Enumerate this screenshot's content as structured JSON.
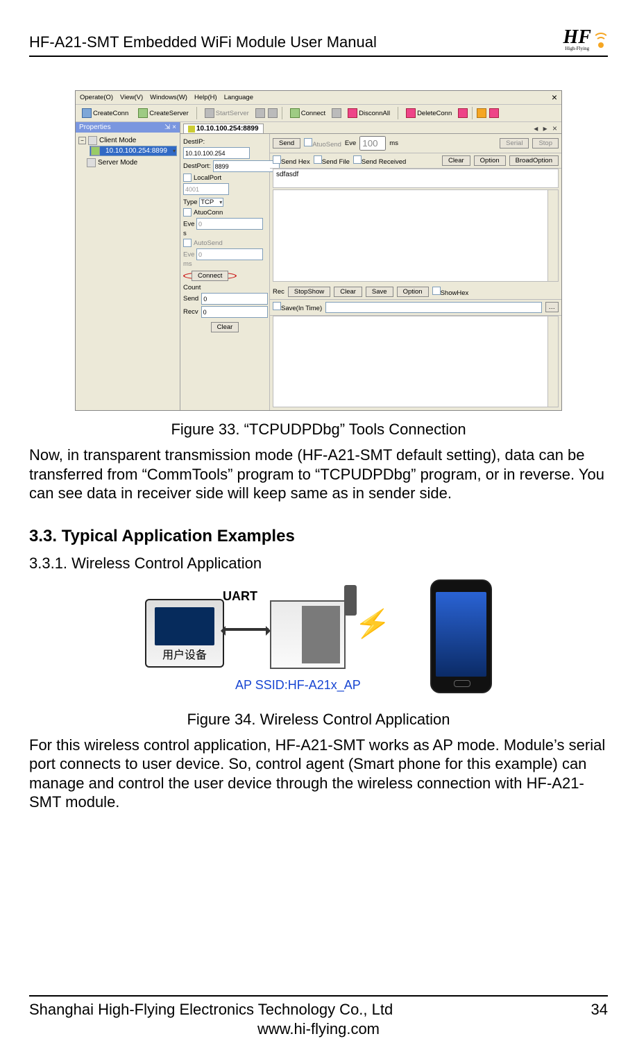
{
  "header": {
    "title": "HF-A21-SMT  Embedded WiFi Module User Manual",
    "logo_text": "HF",
    "logo_sub": "High-Flying"
  },
  "app": {
    "menu": {
      "operate": "Operate(O)",
      "view": "View(V)",
      "windows": "Windows(W)",
      "help": "Help(H)",
      "language": "Language"
    },
    "toolbar": {
      "create_conn": "CreateConn",
      "create_server": "CreateServer",
      "start_server": "StartServer",
      "connect": "Connect",
      "disconn_all": "DisconnAll",
      "delete_conn": "DeleteConn"
    },
    "properties": {
      "title": "Properties",
      "pin": "⇲ ×"
    },
    "tree": {
      "client_mode": "Client Mode",
      "endpoint": "10.10.100.254:8899",
      "server_mode": "Server Mode"
    },
    "tab": "10.10.100.254:8899",
    "tab_icons": "◂ ▸ ×",
    "form": {
      "dest_ip_label": "DestIP:",
      "dest_ip": "10.10.100.254",
      "dest_port_label": "DestPort:",
      "dest_port": "8899",
      "local_port": "LocalPort",
      "local_port_val": "4001",
      "type_label": "Type",
      "type_val": "TCP",
      "atuo_conn": "AtuoConn",
      "eve1_label": "Eve",
      "eve1_val": "0",
      "eve1_unit": "s",
      "auto_send": "AutoSend",
      "eve2_label": "Eve",
      "eve2_val": "0",
      "eve2_unit": "ms",
      "connect_btn": "Connect",
      "count_label": "Count",
      "send_label": "Send",
      "send_val": "0",
      "recv_label": "Recv",
      "recv_val": "0",
      "clear_btn": "Clear"
    },
    "sendbar": {
      "send": "Send",
      "atuo_send": "AtuoSend",
      "eve": "Eve",
      "eve_val": "100",
      "ms": "ms",
      "send_hex": "Send Hex",
      "send_file": "Send File",
      "send_received": "Send Received",
      "serial": "Serial",
      "stop": "Stop",
      "clear": "Clear",
      "option": "Option",
      "broad": "BroadOption"
    },
    "send_text": "sdfasdf",
    "recbar": {
      "rec": "Rec",
      "stop_show": "StopShow",
      "clear": "Clear",
      "save": "Save",
      "option": "Option",
      "show_hex": "ShowHex",
      "save_in_time": "Save(In Time)"
    }
  },
  "fig33_caption": "Figure 33.    “TCPUDPDbg” Tools Connection",
  "para1": "Now, in transparent transmission mode (HF-A21-SMT default setting), data can be transferred from “CommTools” program to “TCPUDPDbg” program, or in reverse. You can see data in receiver side will keep same as in sender side.",
  "h2": "3.3.  Typical Application Examples",
  "h3": "3.3.1.   Wireless Control Application",
  "fig34": {
    "uart": "UART",
    "device_label": "用户设备",
    "ssid": "AP SSID:HF-A21x_AP"
  },
  "fig34_caption": "Figure 34.   Wireless Control Application",
  "para2": "For this wireless control application, HF-A21-SMT works as AP mode. Module’s serial port connects to user device. So, control agent (Smart phone for this example) can manage and control the user device through the wireless connection with HF-A21-SMT module.",
  "footer": {
    "company": "Shanghai High-Flying Electronics Technology Co., Ltd",
    "url": "www.hi-flying.com",
    "page": "34"
  }
}
